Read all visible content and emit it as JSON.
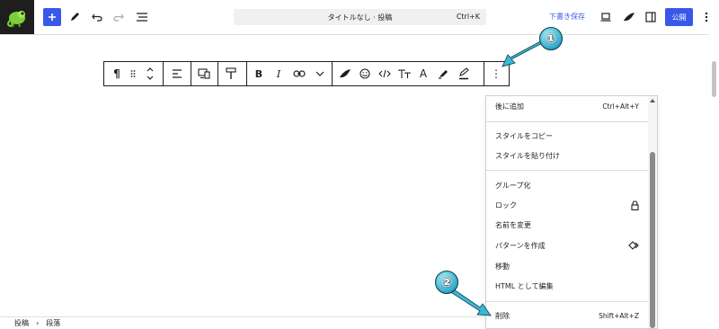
{
  "header": {
    "command_title": "タイトルなし · 投稿",
    "command_shortcut": "Ctrl+K",
    "save_draft": "下書き保存",
    "publish": "公開"
  },
  "toolbar": {
    "paragraph_symbol": "¶",
    "bold": "B",
    "italic": "I",
    "text_color": "A",
    "more": "⋮"
  },
  "menu": {
    "items": [
      {
        "label": "後に追加",
        "shortcut": "Ctrl+Alt+Y"
      },
      {
        "label": "スタイルをコピー"
      },
      {
        "label": "スタイルを貼り付け"
      },
      {
        "label": "グループ化"
      },
      {
        "label": "ロック"
      },
      {
        "label": "名前を変更"
      },
      {
        "label": "パターンを作成"
      },
      {
        "label": "移動"
      },
      {
        "label": "HTML として編集"
      },
      {
        "label": "削除",
        "shortcut": "Shift+Alt+Z"
      }
    ]
  },
  "footer": {
    "crumb_post": "投稿",
    "crumb_paragraph": "段落"
  },
  "annotations": {
    "badge_1": "①",
    "badge_2": "②"
  },
  "colors": {
    "accent": "#3858e9",
    "annotation": "#2aa6c6"
  }
}
